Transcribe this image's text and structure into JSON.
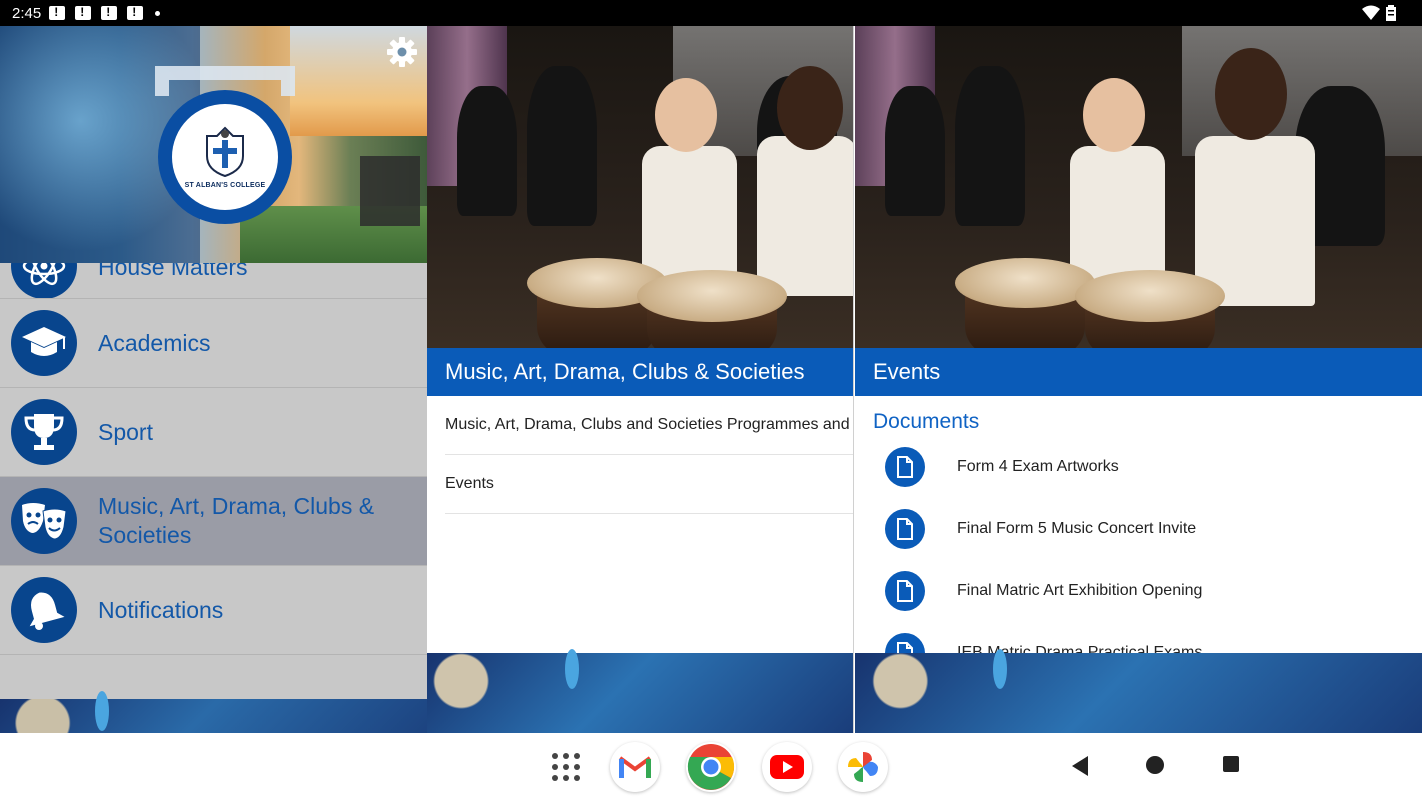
{
  "status": {
    "time": "2:45"
  },
  "drawer": {
    "logo_text": "ST ALBAN'S COLLEGE",
    "items": [
      {
        "label": "House Matters",
        "icon": "atom-icon",
        "active": false
      },
      {
        "label": "Academics",
        "icon": "graduation-cap-icon",
        "active": false
      },
      {
        "label": "Sport",
        "icon": "trophy-icon",
        "active": false
      },
      {
        "label": "Music, Art, Drama, Clubs & Societies",
        "icon": "theater-masks-icon",
        "active": true
      },
      {
        "label": "Notifications",
        "icon": "bell-icon",
        "active": false
      }
    ]
  },
  "middle": {
    "title": "Music, Art, Drama, Clubs & Societies",
    "rows": [
      {
        "label": "Music, Art, Drama, Clubs and Societies Programmes and"
      },
      {
        "label": "Events"
      }
    ]
  },
  "right": {
    "title": "Events",
    "section": "Documents",
    "documents": [
      {
        "label": "Form 4 Exam Artworks"
      },
      {
        "label": "Final Form 5 Music Concert Invite"
      },
      {
        "label": "Final Matric Art Exhibition Opening"
      },
      {
        "label": "IEB Matric Drama Practical Exams"
      }
    ]
  },
  "navbar": {
    "apps": [
      "app-grid-icon",
      "gmail-icon",
      "chrome-icon",
      "youtube-icon",
      "photos-icon"
    ]
  },
  "colors": {
    "primary": "#0a5bb8",
    "drawer_bg": "#c8c8c8",
    "active_bg": "#9a9ca6",
    "label_blue": "#1358a8"
  }
}
